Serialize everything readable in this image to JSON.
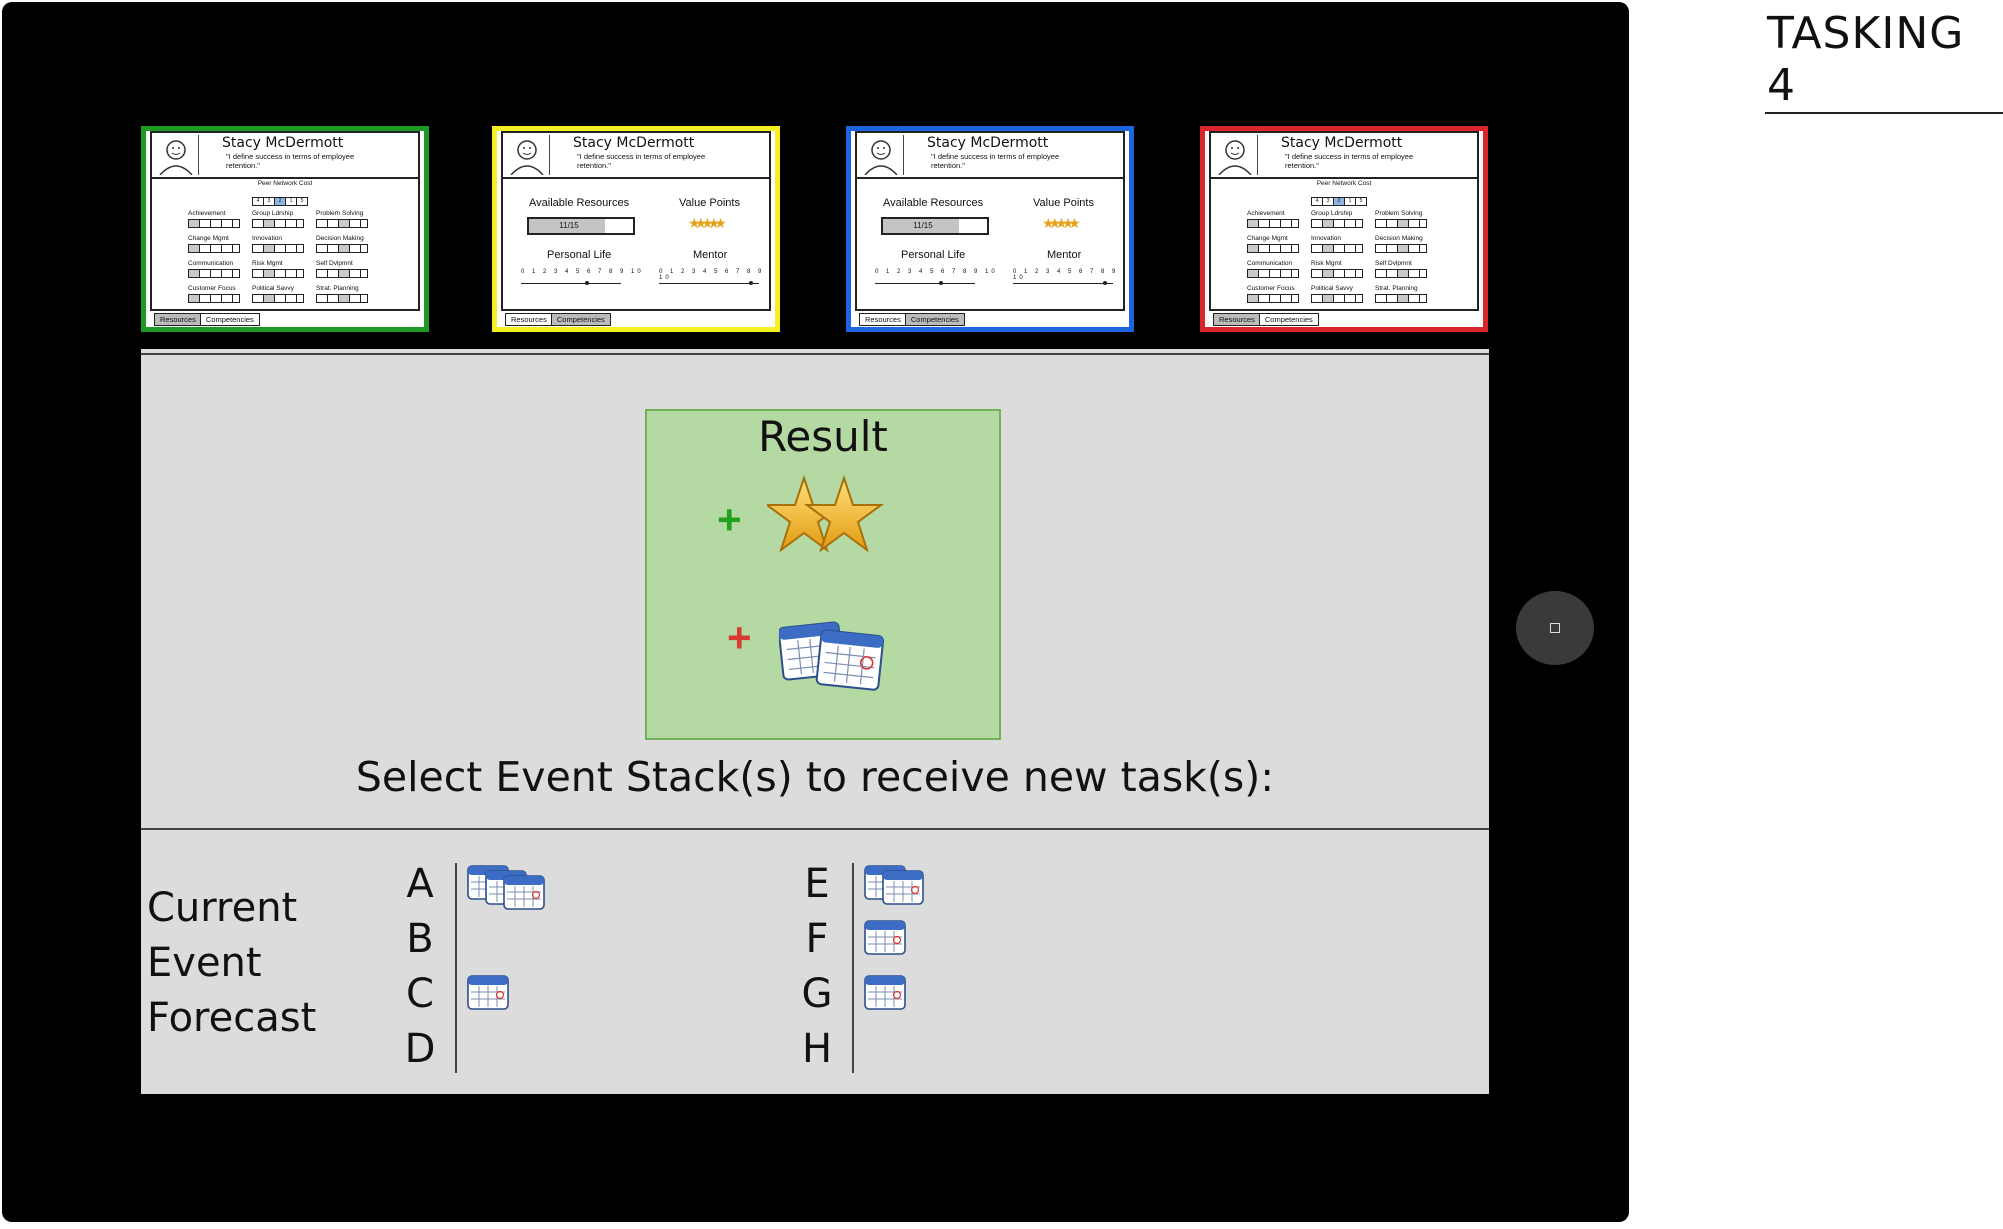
{
  "page_label": "TASKING 4",
  "cards": [
    {
      "color": "#1d9a23",
      "view": "competencies",
      "name": "Stacy McDermott",
      "quote": "\"I define success in terms of employee retention.\"",
      "peer_label": "Peer Network Cost",
      "peer_values": [
        "4",
        "3",
        "2",
        "1",
        "5"
      ],
      "competencies": [
        "Achievement",
        "Group Ldrship",
        "Problem Solving",
        "Change Mgmt",
        "Innovation",
        "Decision Making",
        "Communication",
        "Risk Mgmt",
        "Self Dvlpmnt",
        "Customer Focus",
        "Political Savvy",
        "Strat. Planning"
      ],
      "tabs": [
        "Resources",
        "Competencies"
      ]
    },
    {
      "color": "#f4f023",
      "view": "resources",
      "name": "Stacy McDermott",
      "quote": "\"I define success in terms of employee retention.\"",
      "available_label": "Available Resources",
      "available_value": "11/15",
      "value_points_label": "Value Points",
      "personal_life_label": "Personal Life",
      "mentor_label": "Mentor",
      "scale": "0 1 2 3 4 5 6 7 8 9 10",
      "tabs": [
        "Resources",
        "Competencies"
      ]
    },
    {
      "color": "#1c64e0",
      "view": "resources",
      "name": "Stacy McDermott",
      "quote": "\"I define success in terms of employee retention.\"",
      "available_label": "Available Resources",
      "available_value": "11/15",
      "value_points_label": "Value Points",
      "personal_life_label": "Personal Life",
      "mentor_label": "Mentor",
      "scale": "0 1 2 3 4 5 6 7 8 9 10",
      "tabs": [
        "Resources",
        "Competencies"
      ]
    },
    {
      "color": "#d8262c",
      "view": "competencies",
      "name": "Stacy McDermott",
      "quote": "\"I define success in terms of employee retention.\"",
      "peer_label": "Peer Network Cost",
      "peer_values": [
        "4",
        "3",
        "2",
        "1",
        "5"
      ],
      "competencies": [
        "Achievement",
        "Group Ldrship",
        "Problem Solving",
        "Change Mgmt",
        "Innovation",
        "Decision Making",
        "Communication",
        "Risk Mgmt",
        "Self Dvlpmnt",
        "Customer Focus",
        "Political Savvy",
        "Strat. Planning"
      ],
      "tabs": [
        "Resources",
        "Competencies"
      ]
    }
  ],
  "result": {
    "title": "Result",
    "rewards": [
      {
        "sign": "+",
        "icon": "two-stars-icon",
        "sign_color": "#21a21f"
      },
      {
        "sign": "+",
        "icon": "two-calendars-icon",
        "sign_color": "#d93a32"
      }
    ]
  },
  "select_prompt": "Select Event Stack(s) to receive new task(s):",
  "forecast": {
    "label_lines": [
      "Current",
      "Event",
      "Forecast"
    ],
    "stacks": [
      {
        "letter": "A",
        "count": 3
      },
      {
        "letter": "B",
        "count": 0
      },
      {
        "letter": "C",
        "count": 1
      },
      {
        "letter": "D",
        "count": 0
      },
      {
        "letter": "E",
        "count": 2
      },
      {
        "letter": "F",
        "count": 1
      },
      {
        "letter": "G",
        "count": 1
      },
      {
        "letter": "H",
        "count": 0
      }
    ]
  }
}
